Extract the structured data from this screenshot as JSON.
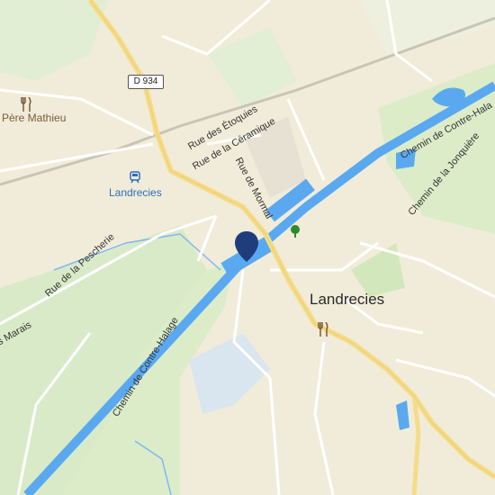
{
  "map": {
    "town_label": "Landrecies",
    "station_label": "Landrecies",
    "poi_restaurant": "Père Mathieu",
    "road_shield": "D 934",
    "streets": {
      "rue_des_etoquies": "Rue des Étoquies",
      "rue_de_la_ceramique": "Rue de la Céramique",
      "rue_de_mormal": "Rue de Mormal",
      "rue_de_la_pescherie": "Rue de la Pescherie",
      "marais": "s Marais",
      "chemin_contre_halage_sw": "Chemin de Contre-Halage",
      "chemin_contre_halage_ne": "Chemin de Contre-Hala",
      "chemin_jonquiere": "Chemin de la Jonquière"
    },
    "icons": {
      "marker": "location-pin-icon",
      "restaurant": "fork-knife-icon",
      "station": "train-icon",
      "park": "tree-icon"
    },
    "colors": {
      "land": "#f1ecd9",
      "green": "#d7e9c6",
      "water": "#5aa9f0",
      "road_major": "#f5dc8a",
      "road_minor": "#ffffff",
      "marker": "#1f3d7a"
    }
  }
}
